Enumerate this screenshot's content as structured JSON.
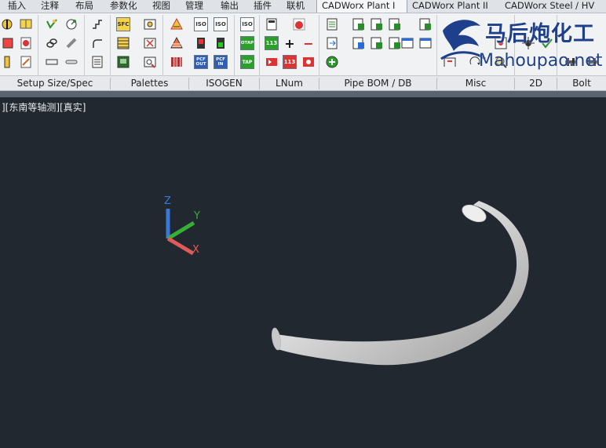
{
  "menu_tabs": [
    {
      "label": "插入"
    },
    {
      "label": "注释"
    },
    {
      "label": "布局"
    },
    {
      "label": "参数化"
    },
    {
      "label": "视图"
    },
    {
      "label": "管理"
    },
    {
      "label": "输出"
    },
    {
      "label": "插件"
    },
    {
      "label": "联机"
    },
    {
      "label": "CADWorx Plant I",
      "active": true
    },
    {
      "label": "CADWorx Plant II"
    },
    {
      "label": "CADWorx Steel / HV"
    }
  ],
  "panels": {
    "setup": "Setup Size/Spec",
    "palettes": "Palettes",
    "isogen": "ISOGEN",
    "lnum": "LNum",
    "pipe_bom": "Pipe BOM / DB",
    "misc": "Misc",
    "twod": "2D",
    "bolt": "Bolt"
  },
  "icon_text": {
    "sfc": "SFC",
    "iso": "ISO",
    "pcf_out": "PCF OUT",
    "pcf_in": "PCF IN",
    "otap": "OTAP",
    "tap": "TAP",
    "n113": "113",
    "plus": "+",
    "minus": "−"
  },
  "viewport": {
    "label": "][东南等轴测][真实]",
    "background": "#212830"
  },
  "ucs": {
    "x": "X",
    "y": "Y",
    "z": "Z"
  },
  "watermark": {
    "cn": "马后炮化工",
    "en": "Mahoupao.net"
  },
  "colors": {
    "accent_tab": "#f5f6f8",
    "ucs_x": "#e05a5a",
    "ucs_y": "#35b035",
    "ucs_z": "#3a78d8",
    "watermark": "#1e3f8c"
  }
}
